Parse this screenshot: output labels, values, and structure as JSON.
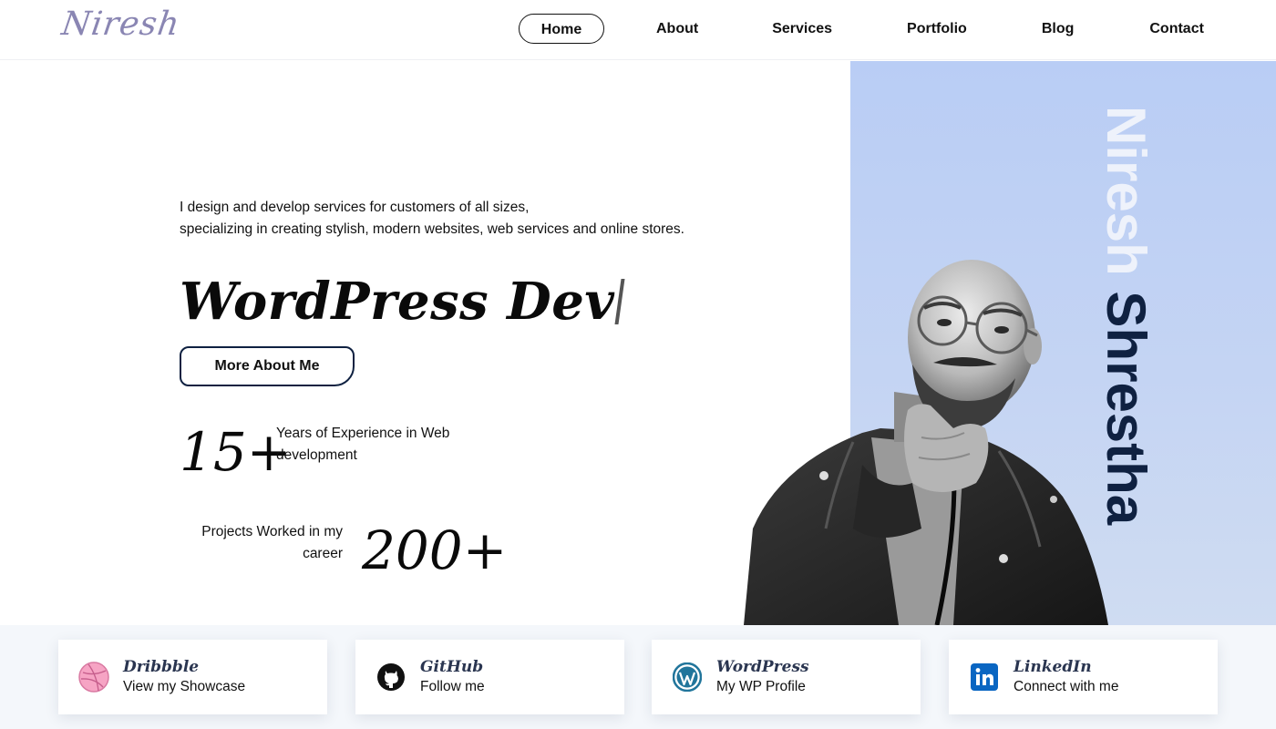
{
  "logo": {
    "text": "Niresh"
  },
  "nav": {
    "items": [
      "Home",
      "About",
      "Services",
      "Portfolio",
      "Blog",
      "Contact"
    ],
    "active": "Home"
  },
  "hero": {
    "intro_line1": "I design and develop services for customers of all sizes,",
    "intro_line2": "specializing in creating stylish, modern websites, web services and online stores.",
    "role_text": "WordPress Dev",
    "button_label": "More About Me",
    "stat1": {
      "number": "15+",
      "label": "Years of Experience in Web development"
    },
    "stat2": {
      "number": "200+",
      "label": "Projects Worked in my career"
    },
    "vertical_name": {
      "first": "Niresh",
      "last": "Shrestha"
    }
  },
  "social": [
    {
      "title": "Dribbble",
      "subtitle": "View my Showcase",
      "icon": "dribbble-icon",
      "color": "#f4a0c0"
    },
    {
      "title": "GitHub",
      "subtitle": "Follow me",
      "icon": "github-icon",
      "color": "#111111"
    },
    {
      "title": "WordPress",
      "subtitle": "My WP Profile",
      "icon": "wordpress-icon",
      "color": "#21759b"
    },
    {
      "title": "LinkedIn",
      "subtitle": "Connect with me",
      "icon": "linkedin-icon",
      "color": "#0a66c2"
    }
  ],
  "colors": {
    "panel": "#b9cdf5",
    "name_dark": "#0f2141",
    "name_light": "#eef2fb",
    "logo": "#8a86b3"
  }
}
